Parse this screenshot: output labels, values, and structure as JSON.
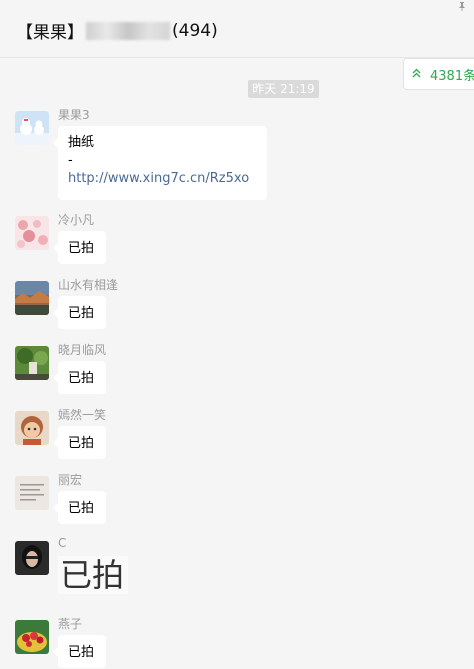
{
  "header": {
    "title_prefix": "【果果】",
    "title_suffix": "(494)",
    "pin_icon": "pin-icon"
  },
  "unread": {
    "arrow": "«",
    "text": "4381条"
  },
  "time_divider": "昨天 21:19",
  "messages": [
    {
      "name": "果果3",
      "text_line1": "抽纸",
      "text_line2": "-",
      "link": "http://www.xing7c.cn/Rz5xo"
    },
    {
      "name": "冷小凡",
      "text": "已拍"
    },
    {
      "name": "山水有相逢",
      "text": "已拍"
    },
    {
      "name": "晓月临风",
      "text": "已拍"
    },
    {
      "name": "嫣然一笑",
      "text": "已拍"
    },
    {
      "name": "丽宏",
      "text": "已拍"
    },
    {
      "name": "C",
      "text": "已拍"
    },
    {
      "name": "燕子",
      "text": "已拍"
    }
  ],
  "colors": {
    "link": "#4a6a96",
    "unread": "#2fa84f",
    "background": "#f5f5f5"
  }
}
